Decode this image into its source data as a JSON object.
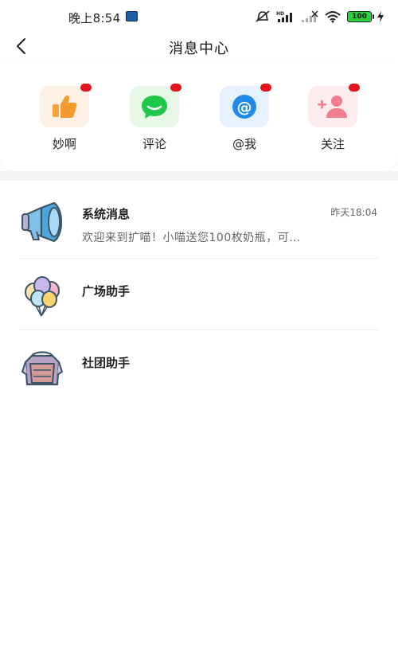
{
  "status_bar": {
    "time": "晚上8:54",
    "battery": "100",
    "icons": [
      "mute-bell-icon",
      "hd-signal-icon",
      "signal-icon",
      "wifi-icon",
      "battery-icon",
      "charging-icon"
    ]
  },
  "header": {
    "title": "消息中心",
    "back_icon": "back-arrow-icon"
  },
  "quick_entries": [
    {
      "label": "妙啊",
      "icon": "thumbs-up-icon",
      "bg": "#fdf0e4",
      "accent": "#f59a2e",
      "badge": true
    },
    {
      "label": "评论",
      "icon": "chat-bubble-icon",
      "bg": "#e7f8e9",
      "accent": "#1fc84a",
      "badge": true
    },
    {
      "label": "@我",
      "icon": "at-sign-icon",
      "bg": "#e6f1fd",
      "accent": "#1f8ae8",
      "badge": true
    },
    {
      "label": "关注",
      "icon": "add-user-icon",
      "bg": "#fdecee",
      "accent": "#f07e8e",
      "badge": true
    }
  ],
  "messages": [
    {
      "name": "系统消息",
      "time": "昨天18:04",
      "preview": "欢迎来到扩喵！小喵送您100枚奶瓶，可…",
      "icon": "megaphone-icon"
    },
    {
      "name": "广场助手",
      "time": "",
      "preview": "",
      "icon": "balloons-icon"
    },
    {
      "name": "社团助手",
      "time": "",
      "preview": "",
      "icon": "backpack-icon"
    }
  ],
  "colors": {
    "badge": "#e2141c",
    "separator": "#f3f3f3"
  }
}
